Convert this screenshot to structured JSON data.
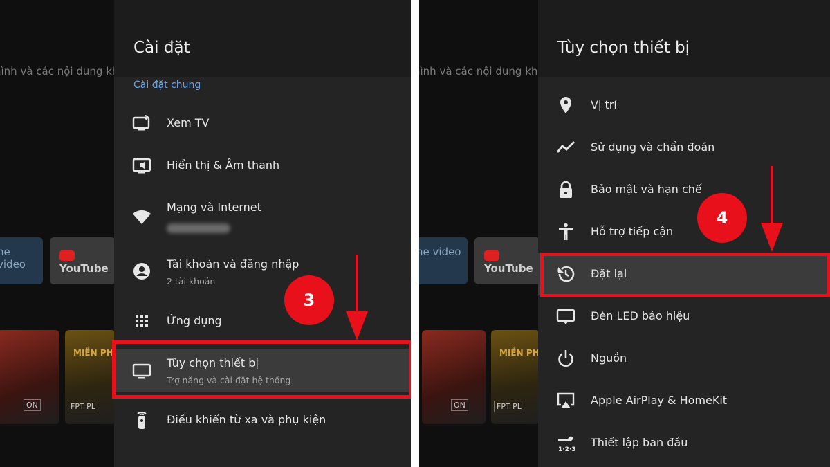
{
  "background": {
    "partial_text": "hình và các nội dung kh",
    "tiles": {
      "prime_label": "ne video",
      "youtube_label": "YouTube",
      "poster_title": "MIỀN PH",
      "poster_badge_on": "ON",
      "poster_badge_fpt": "FPT PL"
    }
  },
  "left": {
    "title": "Cài đặt",
    "section": "Cài đặt chung",
    "items": [
      {
        "label": "Xem TV",
        "sub": ""
      },
      {
        "label": "Hiển thị & Âm thanh",
        "sub": ""
      },
      {
        "label": "Mạng và Internet",
        "sub": ""
      },
      {
        "label": "Tài khoản và đăng nhập",
        "sub": "2 tài khoản"
      },
      {
        "label": "Ứng dụng",
        "sub": ""
      },
      {
        "label": "Tùy chọn thiết bị",
        "sub": "Trợ năng và cài đặt hệ thống"
      },
      {
        "label": "Điều khiển từ xa và phụ kiện",
        "sub": ""
      }
    ],
    "step": "3"
  },
  "right": {
    "title": "Tùy chọn thiết bị",
    "items": [
      {
        "label": "Vị trí"
      },
      {
        "label": "Sử dụng và chẩn đoán"
      },
      {
        "label": "Bảo mật và hạn chế"
      },
      {
        "label": "Hỗ trợ tiếp cận"
      },
      {
        "label": "Đặt lại"
      },
      {
        "label": "Đèn LED báo hiệu"
      },
      {
        "label": "Nguồn"
      },
      {
        "label": "Apple AirPlay & HomeKit"
      },
      {
        "label": "Thiết lập ban đầu"
      }
    ],
    "step": "4"
  },
  "colors": {
    "highlight": "#e8101a",
    "accent_section": "#6aa3e8",
    "panel": "#242424"
  },
  "icons": {
    "left": [
      "tv-cast-icon",
      "display-sound-icon",
      "wifi-icon",
      "account-icon",
      "apps-grid-icon",
      "monitor-icon",
      "remote-icon"
    ],
    "right": [
      "location-pin-icon",
      "usage-chart-icon",
      "lock-icon",
      "accessibility-icon",
      "reset-history-icon",
      "led-indicator-icon",
      "power-icon",
      "airplay-icon",
      "setup-123-icon"
    ]
  }
}
